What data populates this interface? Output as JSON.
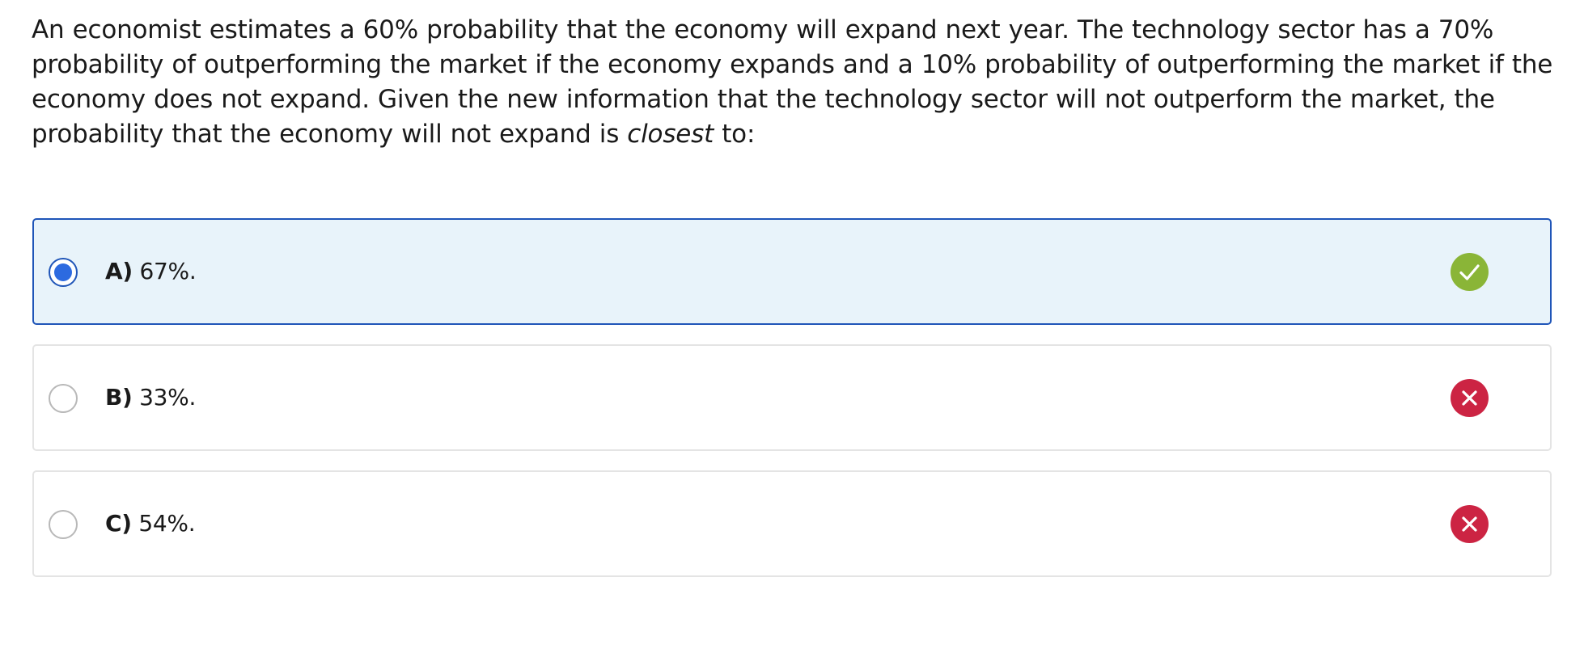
{
  "question": {
    "text_main": "An economist estimates a 60% probability that the economy will expand next year. The technology sector has a 70% probability of outperforming the market if the economy expands and a 10% probability of outperforming the market if the economy does not expand. Given the new information that the technology sector will not outperform the market, the probability that the economy will not expand is ",
    "text_emphasis": "closest",
    "text_end": " to:"
  },
  "options": [
    {
      "letter": "A)",
      "value": "67%.",
      "selected": true,
      "result": "correct",
      "status_icon": "check-icon"
    },
    {
      "letter": "B)",
      "value": "33%.",
      "selected": false,
      "result": "incorrect",
      "status_icon": "x-icon"
    },
    {
      "letter": "C)",
      "value": "54%.",
      "selected": false,
      "result": "incorrect",
      "status_icon": "x-icon"
    }
  ],
  "colors": {
    "selected_border": "#1f55b8",
    "selected_background": "#e8f3fa",
    "radio_fill": "#2c6ae0",
    "correct": "#8ab537",
    "incorrect": "#cc2443"
  }
}
